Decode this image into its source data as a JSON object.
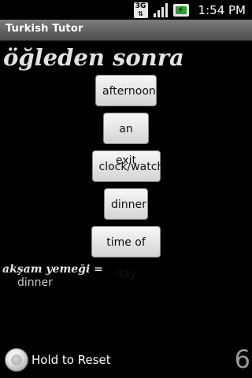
{
  "status_bar": {
    "network_badge": "3G",
    "network_arrows": "⇅",
    "signal_icon": "signal-bars-icon",
    "battery_icon": "battery-charging-icon",
    "time": "1:54 PM"
  },
  "app": {
    "title": "Turkish Tutor"
  },
  "quiz": {
    "prompt": "öğleden sonra",
    "choices": [
      {
        "label": "afternoon"
      },
      {
        "label": "an exit"
      },
      {
        "label": "clock/watch"
      },
      {
        "label": "dinner"
      },
      {
        "label": "time of day"
      }
    ]
  },
  "history": {
    "term": "akşam yemeği =",
    "answer": "dinner"
  },
  "footer": {
    "reset_label": "Hold to Reset",
    "score": "6"
  },
  "colors": {
    "background": "#000000",
    "title_bar": "#6a6a6a",
    "button_face": "#e8e8e8",
    "battery_fill": "#2e9e35"
  }
}
